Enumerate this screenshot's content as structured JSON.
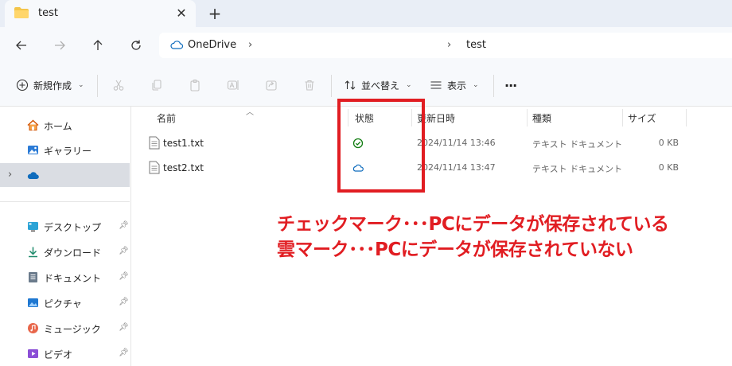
{
  "tab": {
    "title": "test",
    "close_glyph": "✕",
    "new_tab_glyph": "+"
  },
  "address": {
    "root": "OneDrive",
    "chevron": "›",
    "current": "test"
  },
  "toolbar": {
    "new_label": "新規作成",
    "sort_label": "並べ替え",
    "view_label": "表示",
    "more_glyph": "···"
  },
  "sidebar": {
    "items": [
      {
        "label": "ホーム",
        "icon": "home-icon"
      },
      {
        "label": "ギャラリー",
        "icon": "gallery-icon"
      },
      {
        "label": "",
        "icon": "onedrive-cloud-icon",
        "selected": true
      },
      {
        "label": "デスクトップ",
        "icon": "desktop-icon",
        "pinned": true
      },
      {
        "label": "ダウンロード",
        "icon": "download-icon",
        "pinned": true
      },
      {
        "label": "ドキュメント",
        "icon": "document-icon",
        "pinned": true
      },
      {
        "label": "ピクチャ",
        "icon": "pictures-icon",
        "pinned": true
      },
      {
        "label": "ミュージック",
        "icon": "music-icon",
        "pinned": true
      },
      {
        "label": "ビデオ",
        "icon": "video-icon",
        "pinned": true
      }
    ]
  },
  "columns": {
    "name": "名前",
    "status": "状態",
    "modified": "更新日時",
    "type": "種類",
    "size": "サイズ"
  },
  "files": [
    {
      "name": "test1.txt",
      "status": "synced-check-icon",
      "modified": "2024/11/14 13:46",
      "type": "テキスト ドキュメント",
      "size": "0 KB"
    },
    {
      "name": "test2.txt",
      "status": "cloud-only-icon",
      "modified": "2024/11/14 13:47",
      "type": "テキスト ドキュメント",
      "size": "0 KB"
    }
  ],
  "annotation": {
    "line1": "チェックマーク･･･PCにデータが保存されている",
    "line2": "雲マーク･･･PCにデータが保存されていない"
  },
  "colors": {
    "accent": "#0f6cbd",
    "annotation_red": "#e11d22",
    "synced_green": "#107c10"
  }
}
